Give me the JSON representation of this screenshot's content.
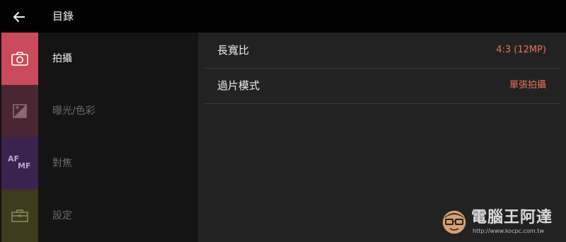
{
  "header": {
    "title": "目錄",
    "back_icon": "arrow-left-icon"
  },
  "sidebar": {
    "items": [
      {
        "label": "拍攝",
        "icon": "camera-icon",
        "color": "#c94a5a",
        "active": true
      },
      {
        "label": "曝光/色彩",
        "icon": "exposure-icon",
        "color": "#4a2532",
        "active": false
      },
      {
        "label": "對焦",
        "icon": "af-mf-icon",
        "icon_text_main": "AF",
        "icon_text_sub": "MF",
        "color": "#3b2350",
        "active": false
      },
      {
        "label": "設定",
        "icon": "toolbox-icon",
        "color": "#3d3c1c",
        "active": false
      }
    ]
  },
  "settings": {
    "rows": [
      {
        "label": "長寬比",
        "value": "4:3 (12MP)"
      },
      {
        "label": "過片模式",
        "value": "單張拍攝"
      }
    ],
    "value_color": "#e8735a"
  },
  "watermark": {
    "text": "電腦王阿達",
    "url": "http://www.kocpc.com.tw"
  }
}
